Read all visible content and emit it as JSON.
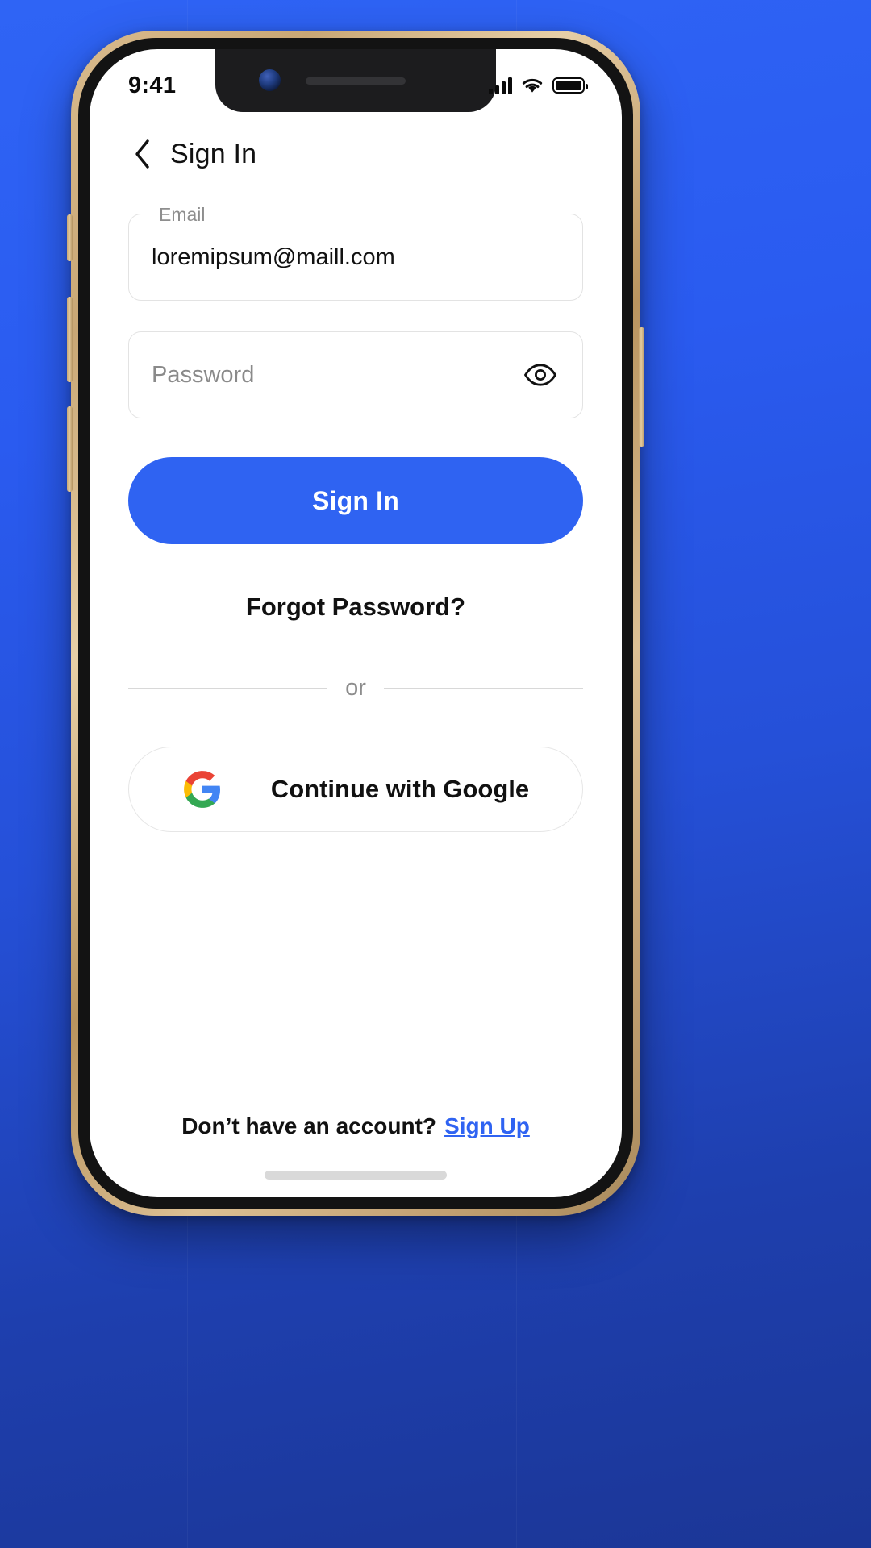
{
  "background": {
    "gradient_top": "#2f64f5",
    "gradient_bottom": "#1b3696"
  },
  "theme": {
    "accent": "#2f63f2",
    "text_primary": "#111111",
    "text_muted": "#8e8e8e",
    "border": "#e3e3e3",
    "device_frame": "#c9a775"
  },
  "status_bar": {
    "time": "9:41",
    "icons": [
      "cellular-signal-icon",
      "wifi-icon",
      "battery-icon"
    ],
    "battery_full": true
  },
  "nav": {
    "back_icon": "chevron-left-icon",
    "title": "Sign In"
  },
  "form": {
    "email": {
      "label": "Email",
      "value": "loremipsum@maill.com",
      "placeholder": "Email"
    },
    "password": {
      "placeholder": "Password",
      "value": "",
      "toggle_icon": "eye-icon"
    }
  },
  "actions": {
    "primary_button": "Sign In",
    "forgot_password": "Forgot Password?",
    "divider_label": "or",
    "google_button": "Continue with Google",
    "google_icon": "google-g-icon"
  },
  "footer": {
    "question": "Don’t have an account?",
    "link": "Sign Up"
  }
}
